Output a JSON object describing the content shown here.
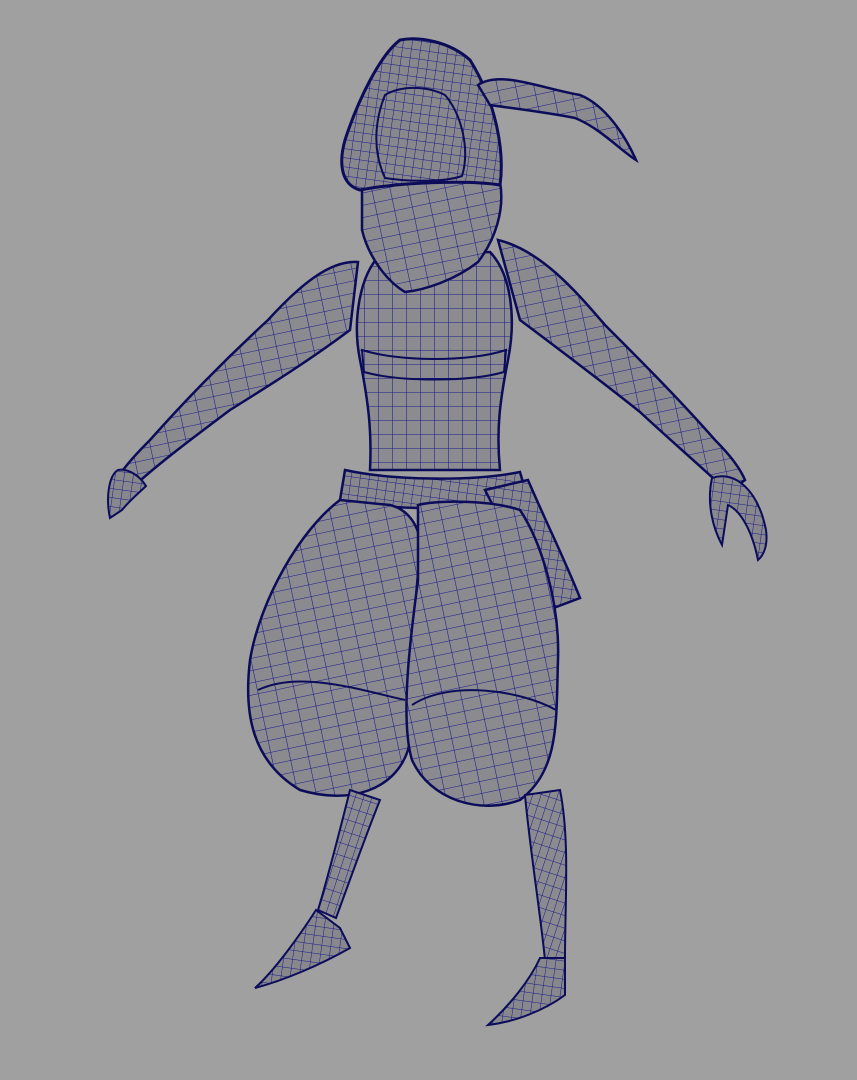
{
  "viewport": {
    "background_color": "#a0a0a0",
    "subject": "wireframe-character-model"
  },
  "colors": {
    "surface": "#8c8c90",
    "surface_shadow": "#6e6e74",
    "wire": "#1a1a8c",
    "wire_dark": "#0c0c5a"
  }
}
